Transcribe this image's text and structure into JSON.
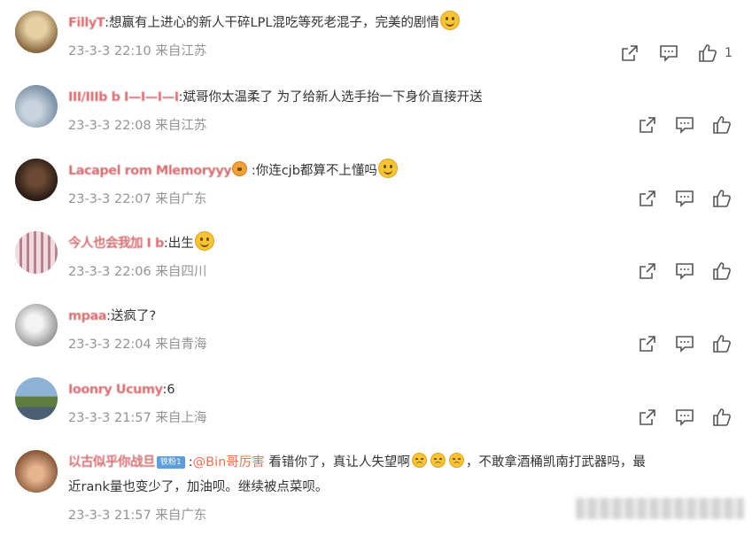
{
  "comments": [
    {
      "username": "FillyT",
      "text_parts": [
        ":想赢有上进心的新人干碎LPL混吃等死老混子，完美的剧情"
      ],
      "emoji": "smile",
      "time": "23-3-3 22:10",
      "location": "来自江苏",
      "likes": "1",
      "avatar_color": "#b79a6c"
    },
    {
      "username": "III/IIIb b  I—I—I—I",
      "text_parts": [
        ":斌哥你太温柔了  为了给新人选手抬一下身价直接开送"
      ],
      "time": "23-3-3 22:08",
      "location": "来自江苏",
      "likes": "",
      "avatar_color": "#8fa7bd"
    },
    {
      "username": "Lacapel rom Mlemoryyy",
      "text_parts": [
        " :你连cjb都算不上懂吗"
      ],
      "emoji": "laugh",
      "time": "23-3-3 22:07",
      "location": "来自广东",
      "likes": "",
      "avatar_color": "#3e2a1f"
    },
    {
      "username": "今人也会我加 I b",
      "text_parts": [
        ":出生"
      ],
      "emoji": "grin",
      "time": "23-3-3 22:06",
      "location": "来自四川",
      "likes": "",
      "avatar_color": "#e3b9c6"
    },
    {
      "username": "mpaa",
      "text_parts": [
        ":送疯了?"
      ],
      "time": "23-3-3 22:04",
      "location": "来自青海",
      "likes": "",
      "avatar_color": "#c7c7c7"
    },
    {
      "username": "Ioonry Ucumy",
      "text_parts": [
        ":6"
      ],
      "time": "23-3-3 21:57",
      "location": "来自上海",
      "likes": "",
      "avatar_color": "#6e93b8"
    },
    {
      "username": "以古似乎你战旦",
      "badge": "铁粉1",
      "mention": "@Bin哥厉害",
      "text_line1": " 看错你了，真让人失望啊",
      "text_line1b": "，不敢拿酒桶凯南打武器吗，最",
      "text_line2": "近rank量也变少了，加油呗。继续被点菜呗。",
      "time": "23-3-3 21:57",
      "location": "来自广东",
      "likes": "",
      "avatar_color": "#b7835c"
    }
  ],
  "icons": {
    "share": "share-icon",
    "comment": "comment-icon",
    "like": "thumbs-up-icon"
  }
}
